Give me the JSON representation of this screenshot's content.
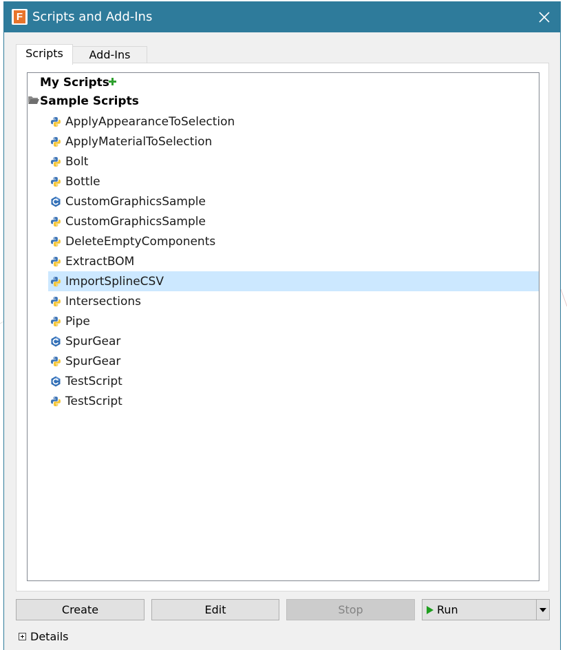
{
  "window": {
    "title": "Scripts and Add-Ins",
    "app_icon_letter": "F",
    "title_bar_color": "#2e7b9b"
  },
  "tabs": [
    {
      "label": "Scripts",
      "active": true
    },
    {
      "label": "Add-Ins",
      "active": false
    }
  ],
  "tree": {
    "my_scripts_label": "My Scripts",
    "sample_scripts_label": "Sample Scripts",
    "selection_color": "#cce8ff",
    "items": [
      {
        "label": "ApplyAppearanceToSelection",
        "icon": "python-icon"
      },
      {
        "label": "ApplyMaterialToSelection",
        "icon": "python-icon"
      },
      {
        "label": "Bolt",
        "icon": "python-icon"
      },
      {
        "label": "Bottle",
        "icon": "python-icon"
      },
      {
        "label": "CustomGraphicsSample",
        "icon": "cpp-icon"
      },
      {
        "label": "CustomGraphicsSample",
        "icon": "python-icon"
      },
      {
        "label": "DeleteEmptyComponents",
        "icon": "python-icon"
      },
      {
        "label": "ExtractBOM",
        "icon": "python-icon"
      },
      {
        "label": "ImportSplineCSV",
        "icon": "python-icon",
        "selected": true
      },
      {
        "label": "Intersections",
        "icon": "python-icon"
      },
      {
        "label": "Pipe",
        "icon": "python-icon"
      },
      {
        "label": "SpurGear",
        "icon": "cpp-icon"
      },
      {
        "label": "SpurGear",
        "icon": "python-icon"
      },
      {
        "label": "TestScript",
        "icon": "cpp-icon"
      },
      {
        "label": "TestScript",
        "icon": "python-icon"
      }
    ]
  },
  "buttons": {
    "create": "Create",
    "edit": "Edit",
    "stop": "Stop",
    "run": "Run"
  },
  "details_label": "Details"
}
